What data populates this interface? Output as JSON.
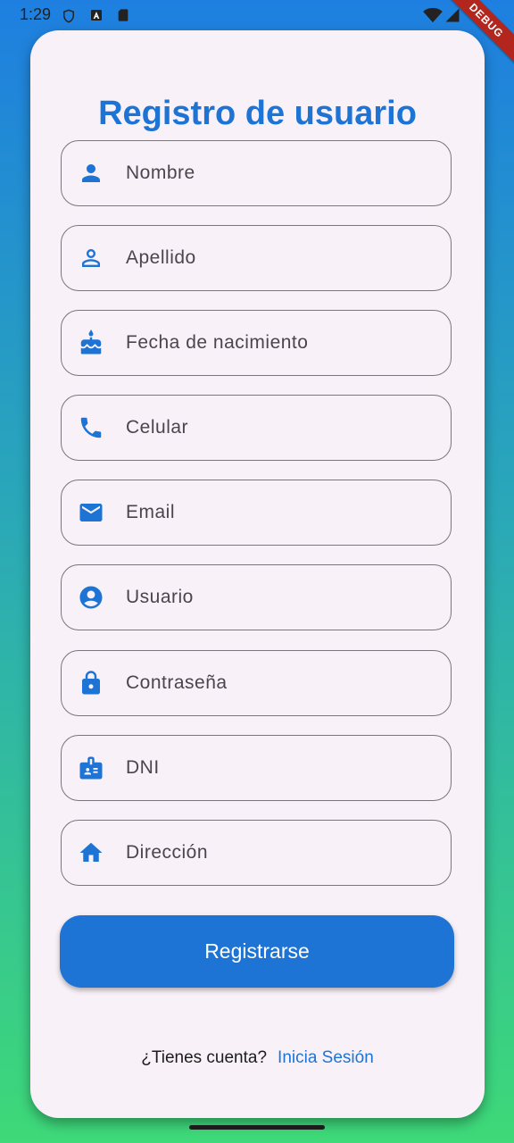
{
  "status_bar": {
    "time": "1:29",
    "debug_label": "DEBUG",
    "icons": [
      "shield-icon",
      "a-icon",
      "sd-card-icon",
      "wifi-icon",
      "signal-icon",
      "battery-icon"
    ]
  },
  "form": {
    "title": "Registro de usuario",
    "fields": [
      {
        "label": "Nombre",
        "icon": "person-icon"
      },
      {
        "label": "Apellido",
        "icon": "person-outline-icon"
      },
      {
        "label": "Fecha de nacimiento",
        "icon": "cake-icon"
      },
      {
        "label": "Celular",
        "icon": "phone-icon"
      },
      {
        "label": "Email",
        "icon": "email-icon"
      },
      {
        "label": "Usuario",
        "icon": "account-circle-icon"
      },
      {
        "label": "Contraseña",
        "icon": "lock-icon"
      },
      {
        "label": "DNI",
        "icon": "id-badge-icon"
      },
      {
        "label": "Dirección",
        "icon": "home-icon"
      }
    ],
    "submit_label": "Registrarse"
  },
  "footer": {
    "prompt": "¿Tienes cuenta?",
    "link": "Inicia Sesión"
  },
  "colors": {
    "accent": "#1d74d4",
    "card_bg": "#f8f1f8",
    "gradient_top": "#1e7fe0",
    "gradient_bottom": "#3ed978"
  }
}
